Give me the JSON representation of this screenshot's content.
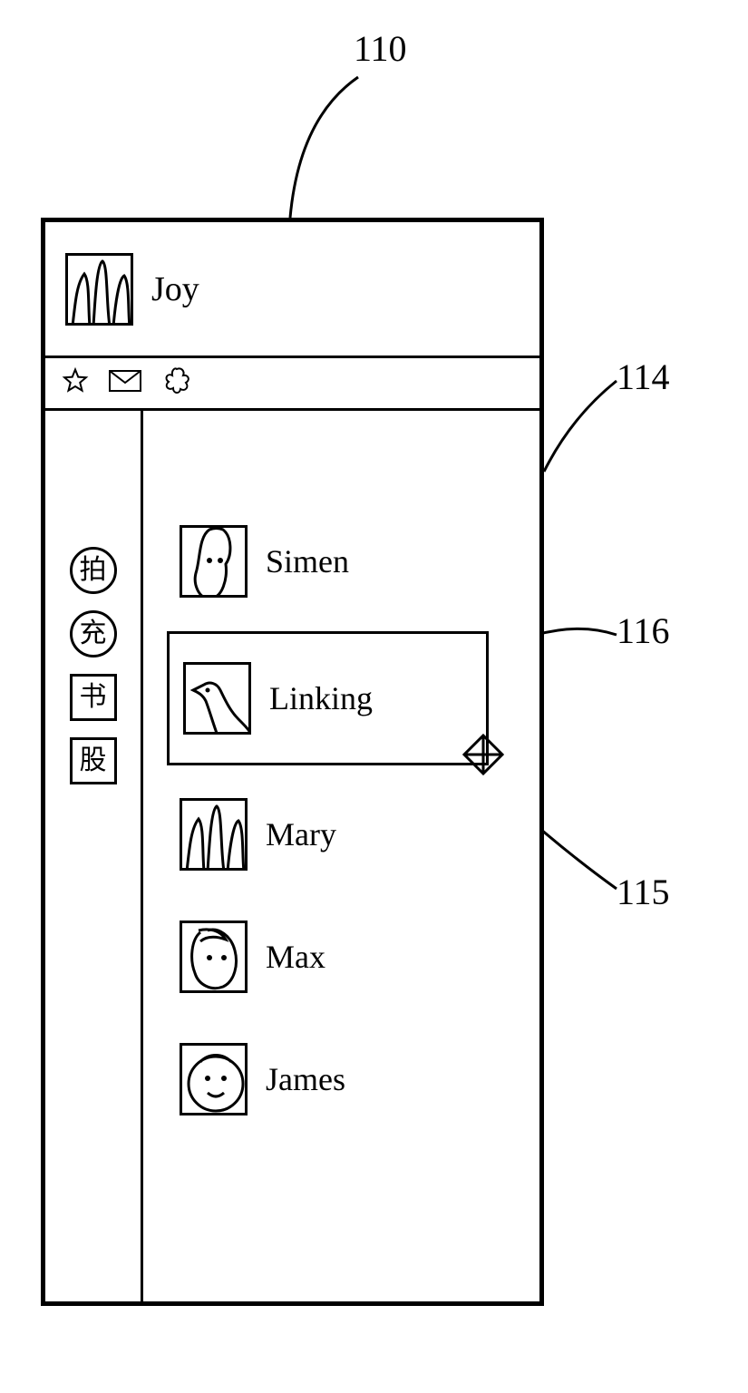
{
  "callouts": {
    "top": "110",
    "panel": "114",
    "selected": "116",
    "cursor": "115"
  },
  "header": {
    "username": "Joy"
  },
  "sidebar": {
    "items": [
      {
        "label": "拍",
        "shape": "circle"
      },
      {
        "label": "充",
        "shape": "circle"
      },
      {
        "label": "书",
        "shape": "square"
      },
      {
        "label": "股",
        "shape": "square"
      }
    ]
  },
  "contacts": [
    {
      "name": "Simen",
      "avatar": "face1",
      "selected": false
    },
    {
      "name": "Linking",
      "avatar": "bird",
      "selected": true
    },
    {
      "name": "Mary",
      "avatar": "mountains",
      "selected": false
    },
    {
      "name": "Max",
      "avatar": "face2",
      "selected": false
    },
    {
      "name": "James",
      "avatar": "face3",
      "selected": false
    }
  ]
}
